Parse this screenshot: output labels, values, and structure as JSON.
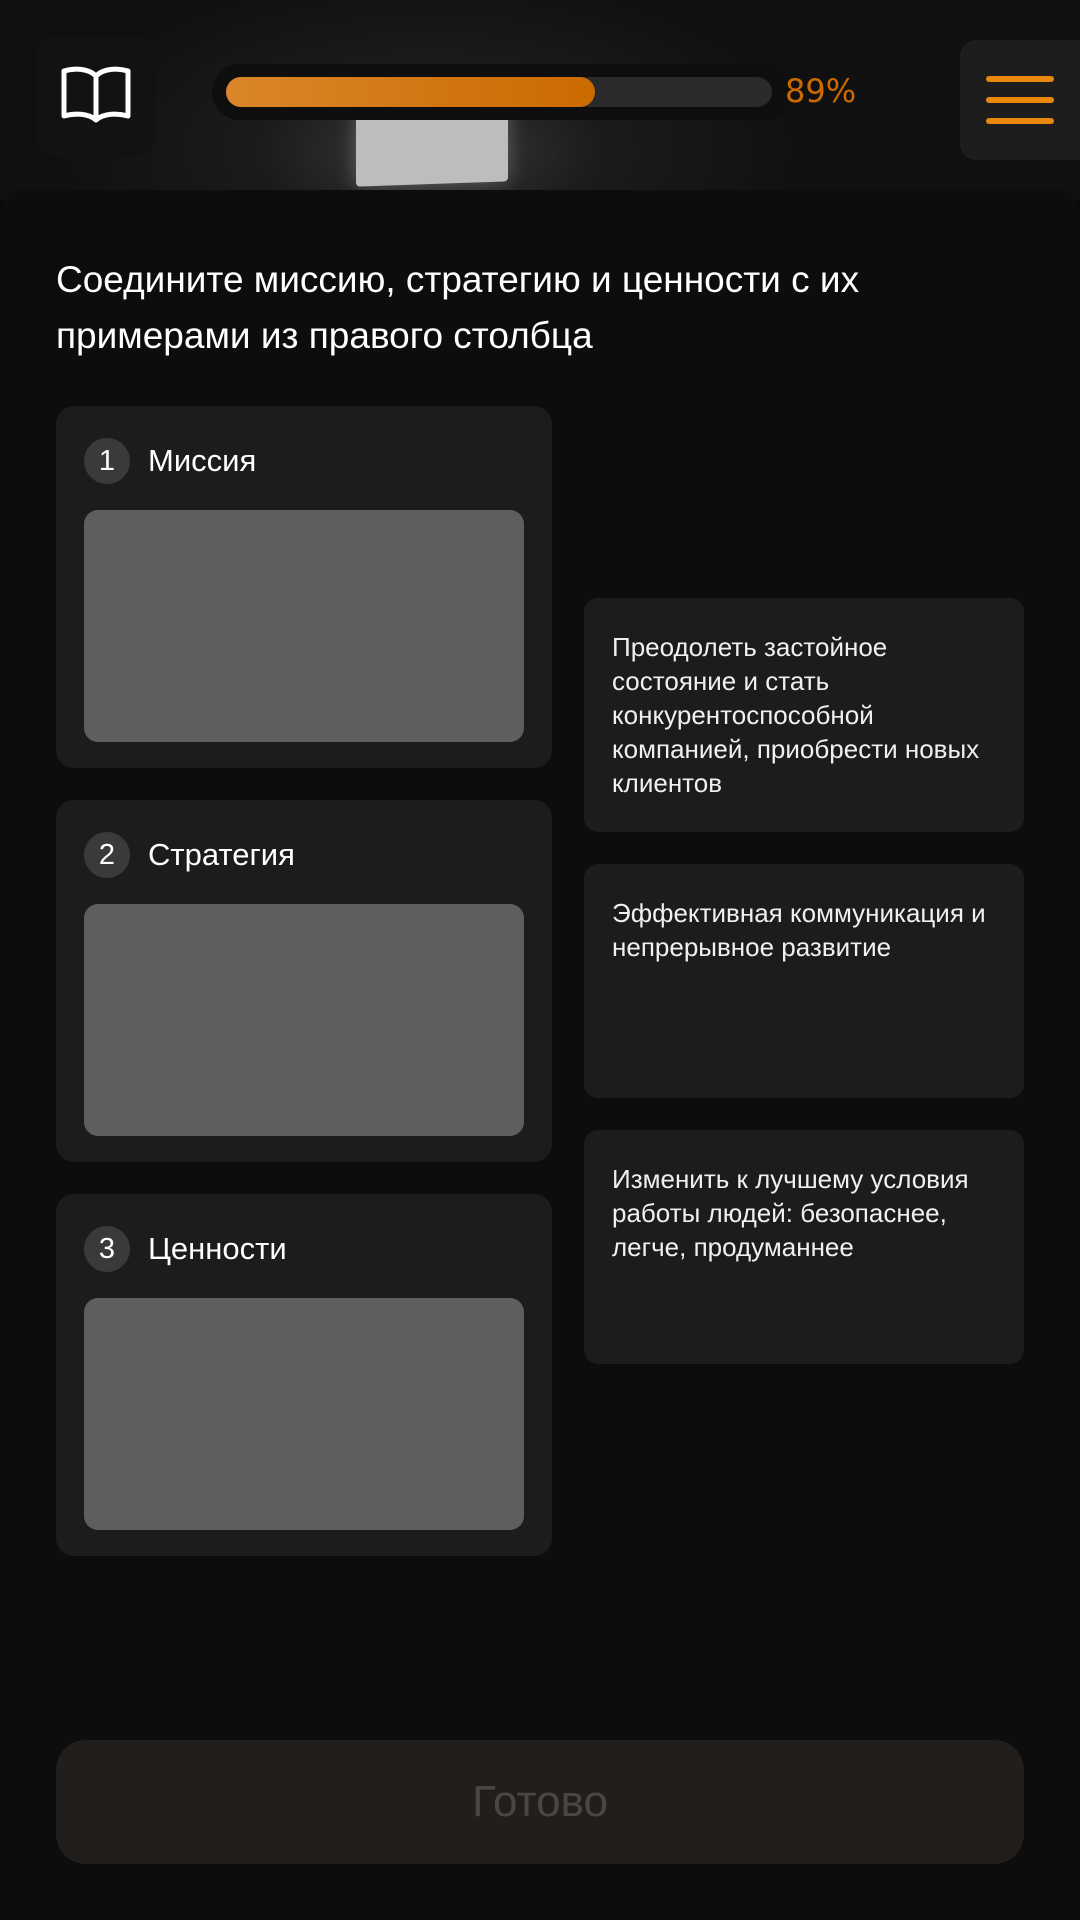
{
  "header": {
    "book_icon": "open-book-icon",
    "menu_icon": "hamburger-menu-icon",
    "progress": {
      "value": 89,
      "label": "89%"
    },
    "accent_color": "#e8870b"
  },
  "task": {
    "title": "Соедините миссию, стратегию и ценности с их примерами  из правого столбца"
  },
  "targets": [
    {
      "number": "1",
      "label": "Миссия"
    },
    {
      "number": "2",
      "label": "Стратегия"
    },
    {
      "number": "3",
      "label": "Ценности"
    }
  ],
  "options": [
    {
      "text": "Преодолеть застойное состояние и стать конкурентоспособной компанией, приобрести новых клиентов"
    },
    {
      "text": "Эффективная коммуникация и непрерывное развитие"
    },
    {
      "text": "Изменить к лучшему условия работы людей: безопаснее, легче, продуманнее"
    }
  ],
  "footer": {
    "done_label": "Готово"
  }
}
